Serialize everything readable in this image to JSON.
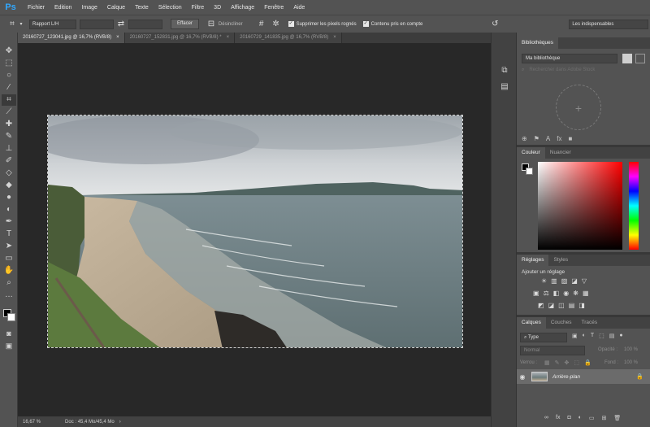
{
  "app": {
    "logo": "Ps"
  },
  "menu": [
    "Fichier",
    "Edition",
    "Image",
    "Calque",
    "Texte",
    "Sélection",
    "Filtre",
    "3D",
    "Affichage",
    "Fenêtre",
    "Aide"
  ],
  "options": {
    "ratio_select": "Rapport L/H",
    "clear_button": "Effacer",
    "straighten_label": "Désincliner",
    "delete_cropped_label": "Supprimer les pixels rognés",
    "delete_cropped_checked": true,
    "content_aware_label": "Contenu pris en compte",
    "content_aware_checked": true,
    "workspace_select": "Les indispensables"
  },
  "tabs": [
    {
      "label": "20160727_123041.jpg @ 16,7% (RVB/8)",
      "close": "×",
      "active": true
    },
    {
      "label": "20160727_152831.jpg @ 16,7% (RVB/8) *",
      "close": "×",
      "active": false
    },
    {
      "label": "20160729_141835.jpg @ 16,7% (RVB/8)",
      "close": "×",
      "active": false
    }
  ],
  "status": {
    "zoom": "16,67 %",
    "doc": "Doc : 45,4 Mo/45,4 Mo"
  },
  "libraries": {
    "tab": "Bibliothèques",
    "select": "Ma bibliothèque",
    "search_placeholder": "Rechercher dans Adobe Stock"
  },
  "color": {
    "tabs": [
      "Couleur",
      "Nuancier"
    ],
    "hue_color": "#ff0000"
  },
  "adjustments": {
    "tabs": [
      "Réglages",
      "Styles"
    ],
    "title": "Ajouter un réglage"
  },
  "layers": {
    "tabs": [
      "Calques",
      "Couches",
      "Tracés"
    ],
    "kind_label": "Type",
    "blend_mode": "Normal",
    "opacity_label": "Opacité :",
    "opacity_value": "100 %",
    "lock_label": "Verrou :",
    "fill_label": "Fond :",
    "fill_value": "100 %",
    "layer_name": "Arrière-plan",
    "bottom_icons": [
      "link-icon",
      "fx-icon",
      "mask-icon",
      "adjustment-icon",
      "group-icon",
      "new-layer-icon",
      "trash-icon"
    ]
  },
  "colors": {
    "accent": "#31a8ff",
    "panel": "#535353",
    "canvas": "#282828"
  }
}
